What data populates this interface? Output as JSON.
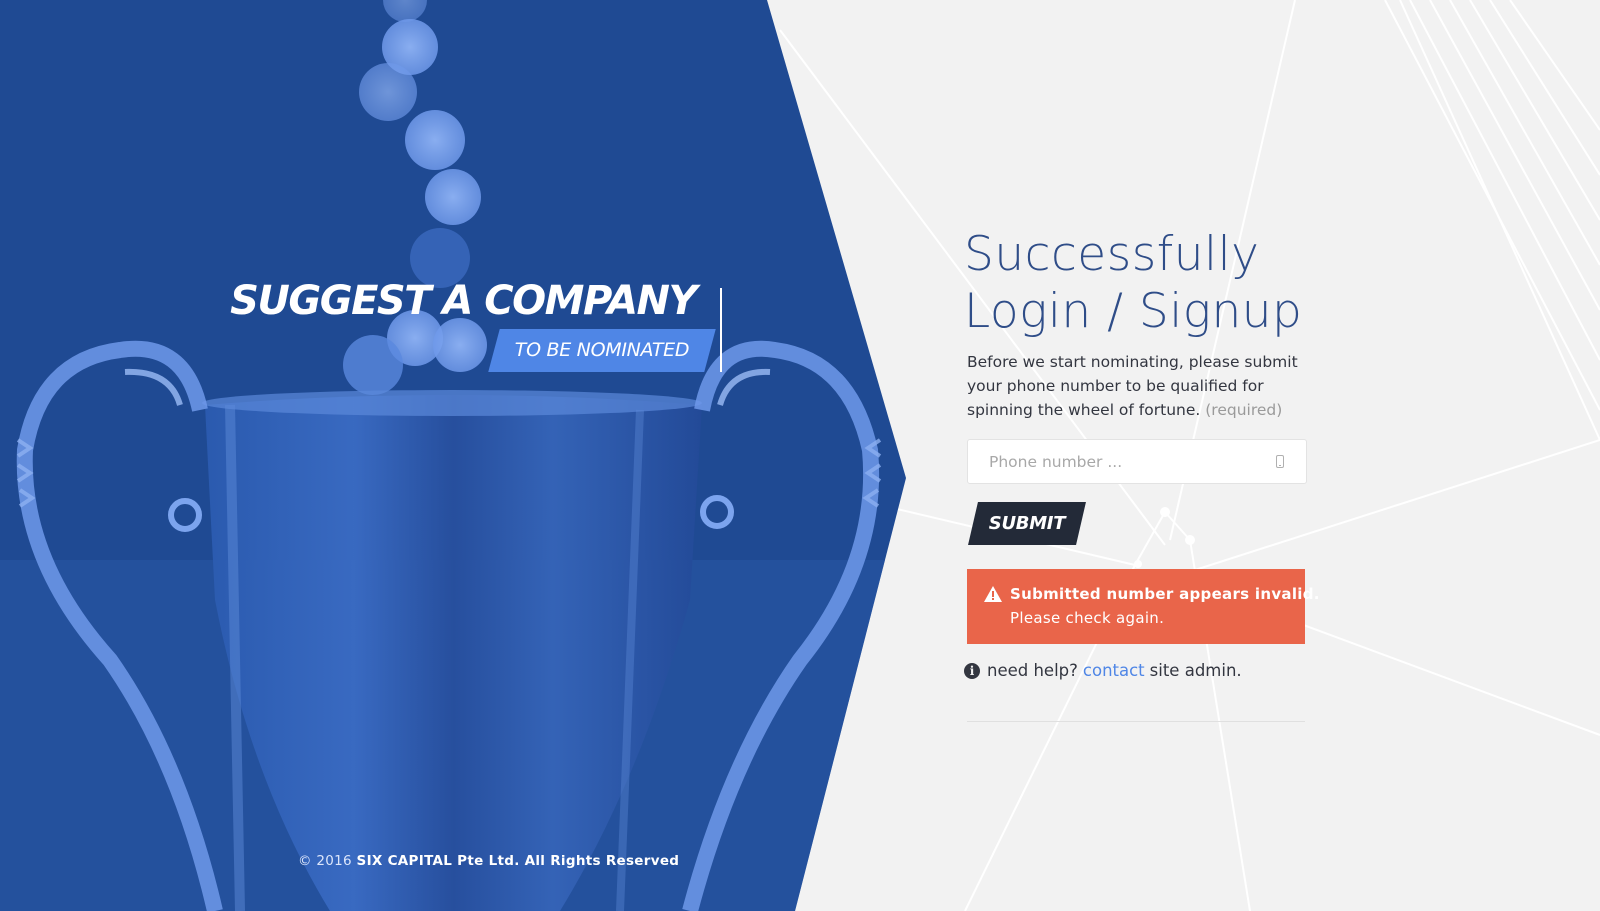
{
  "colors": {
    "hero_blue": "#1f4a93",
    "accent_blue": "#4f86e6",
    "heading_blue": "#2f4d88",
    "alert_red": "#e9654a",
    "dark_button": "#232a38",
    "page_bg": "#f2f2f2"
  },
  "hero": {
    "title": "SUGGEST A COMPANY",
    "tag": "TO BE NOMINATED",
    "image_icon": "trophy-image"
  },
  "footer": {
    "prefix": "© 2016",
    "company": "SIX CAPITAL Pte Ltd. All Rights Reserved"
  },
  "form": {
    "heading_line1": "Successfully",
    "heading_line2": "Login / Signup",
    "description": "Before we start nominating, please submit your phone number to be qualified for spinning the wheel of fortune.",
    "required_note": "(required)",
    "phone": {
      "value": "",
      "placeholder": "Phone number ...",
      "icon": "mobile-phone-icon"
    },
    "submit_label": "SUBMIT",
    "alert": {
      "icon": "warning-icon",
      "title": "Submitted number appears invalid.",
      "message": "Please check again."
    },
    "help": {
      "icon": "info-icon",
      "prefix": "need help?",
      "link": "contact",
      "suffix": "site admin."
    }
  }
}
